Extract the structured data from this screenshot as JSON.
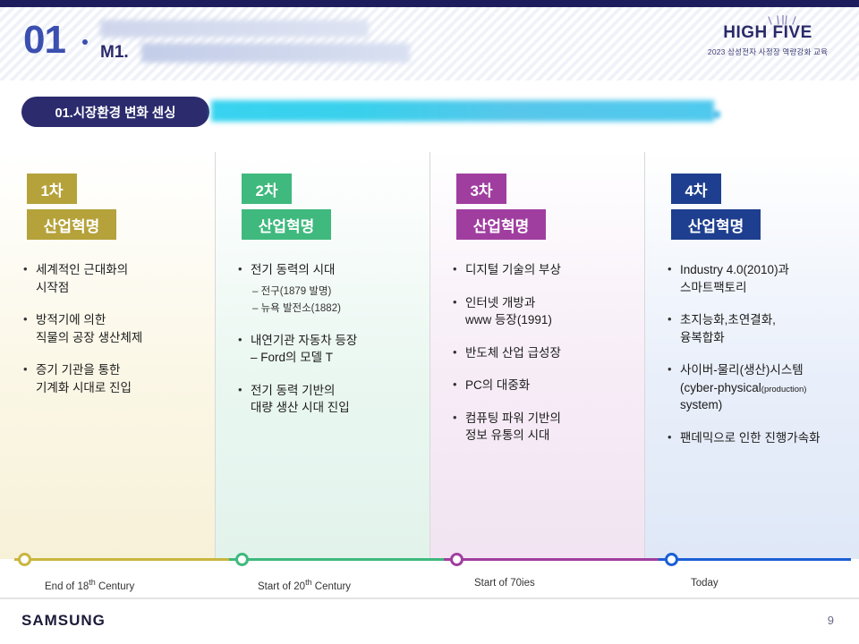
{
  "header": {
    "number": "01",
    "module": "M1.",
    "logo_title": "HIGH FIVE",
    "logo_sub": "2023 삼성전자 사정장 역량강화 교육"
  },
  "section": {
    "tag": "01.시장환경 변화 센싱"
  },
  "columns": [
    {
      "badge_top": "1차",
      "badge_bottom": "산업혁명",
      "accent": "#b5a23a",
      "items": [
        {
          "text": "세계적인 근대화의\n시작점",
          "subs": []
        },
        {
          "text": "방적기에 의한\n직물의 공장 생산체제",
          "subs": []
        },
        {
          "text": "증기 기관을 통한\n기계화 시대로 진입",
          "subs": []
        }
      ],
      "timeline_label": "End of 18th Century",
      "timeline_label_base": "End of 18",
      "timeline_label_sup": "th",
      "timeline_label_tail": " Century"
    },
    {
      "badge_top": "2차",
      "badge_bottom": "산업혁명",
      "accent": "#3fb97e",
      "items": [
        {
          "text": "전기 동력의 시대",
          "subs": [
            "- 전구(1879 발명)",
            "- 뉴욕 발전소(1882)"
          ]
        },
        {
          "text": "내연기관 자동차 등장\n- Ford의 모델 T",
          "subs": []
        },
        {
          "text": "전기 동력 기반의\n대량 생산 시대 진입",
          "subs": []
        }
      ],
      "timeline_label": "Start of 20th Century",
      "timeline_label_base": "Start of 20",
      "timeline_label_sup": "th",
      "timeline_label_tail": " Century"
    },
    {
      "badge_top": "3차",
      "badge_bottom": "산업혁명",
      "accent": "#a03ea0",
      "items": [
        {
          "text": "디지털 기술의 부상",
          "subs": []
        },
        {
          "text": "인터넷 개방과\nwww 등장(1991)",
          "subs": []
        },
        {
          "text": "반도체 산업 급성장",
          "subs": []
        },
        {
          "text": "PC의 대중화",
          "subs": []
        },
        {
          "text": "컴퓨팅 파워 기반의\n정보 유통의 시대",
          "subs": []
        }
      ],
      "timeline_label": "Start of 70ies",
      "timeline_label_base": "Start of 70ies",
      "timeline_label_sup": "",
      "timeline_label_tail": ""
    },
    {
      "badge_top": "4차",
      "badge_bottom": "산업혁명",
      "accent": "#1e3f8f",
      "items": [
        {
          "text": "Industry 4.0(2010)과\n스마트팩토리",
          "subs": []
        },
        {
          "text": "초지능화,초연결화,\n융복합화",
          "subs": []
        },
        {
          "text": "사이버-물리(생산)시스템\n(cyber-physical(production)\nsystem)",
          "subs": []
        },
        {
          "text": "팬데믹으로 인한 진행가속화",
          "subs": []
        }
      ],
      "timeline_label": "Today",
      "timeline_label_base": "Today",
      "timeline_label_sup": "",
      "timeline_label_tail": ""
    }
  ],
  "footer": {
    "brand": "SAMSUNG",
    "page": "9"
  }
}
